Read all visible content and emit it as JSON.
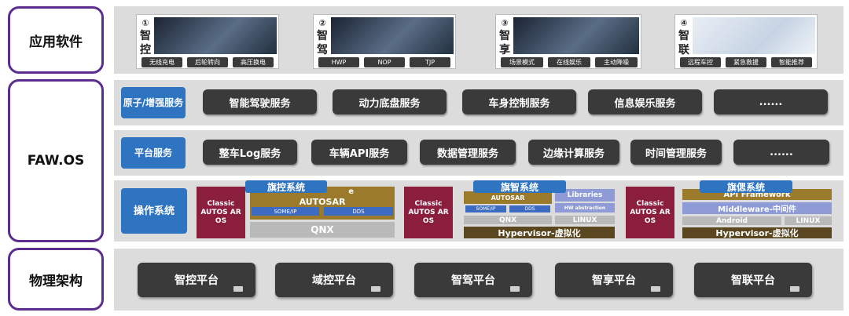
{
  "layers": {
    "app": "应用软件",
    "os": "FAW.OS",
    "physical": "物理架构"
  },
  "apps": [
    {
      "num": "①",
      "name_chars": [
        "智",
        "控"
      ],
      "features": [
        "无线充电",
        "后轮转向",
        "高压换电"
      ]
    },
    {
      "num": "②",
      "name_chars": [
        "智",
        "驾"
      ],
      "features": [
        "HWP",
        "NOP",
        "TJP"
      ]
    },
    {
      "num": "③",
      "name_chars": [
        "智",
        "享"
      ],
      "features": [
        "场景模式",
        "在线娱乐",
        "主动降噪"
      ]
    },
    {
      "num": "④",
      "name_chars": [
        "智",
        "联"
      ],
      "features": [
        "远程车控",
        "紧急救援",
        "智能推荐"
      ]
    }
  ],
  "atomic": {
    "label": "原子/增强服务",
    "items": [
      "智能驾驶服务",
      "动力底盘服务",
      "车身控制服务",
      "信息娱乐服务",
      "......"
    ]
  },
  "platform": {
    "label": "平台服务",
    "items": [
      "整车Log服务",
      "车辆API服务",
      "数据管理服务",
      "边缘计算服务",
      "时间管理服务",
      "......"
    ]
  },
  "os": {
    "label": "操作系统",
    "classic": "Classic AUTOS AR OS",
    "systems": [
      {
        "title": "旗控系统",
        "top_partial": "e",
        "autosar": "AUTOSAR",
        "someip": "SOME/IP",
        "dds": "DDS",
        "base": "QNX"
      },
      {
        "title": "旗智系统",
        "libraries": "Libraries",
        "autosar": "AUTOSAR",
        "someip": "SOME/IP",
        "dds": "DDS",
        "hw": "HW abstraction",
        "qnx": "QNX",
        "linux": "LINUX",
        "hypervisor": "Hypervisor-虚拟化"
      },
      {
        "title": "旗偲系统",
        "api": "API Framework",
        "middleware": "Middleware-中间件",
        "android": "Android",
        "linux": "LINUX",
        "hypervisor": "Hypervisor-虚拟化"
      }
    ]
  },
  "platforms": [
    "智控平台",
    "域控平台",
    "智驾平台",
    "智享平台",
    "智联平台"
  ],
  "colors": {
    "frame": "#5b2d8e",
    "tag": "#2f74c0",
    "pill": "#3a3a3a",
    "classic": "#8b1e3c",
    "autosar": "#9b7b2b"
  }
}
